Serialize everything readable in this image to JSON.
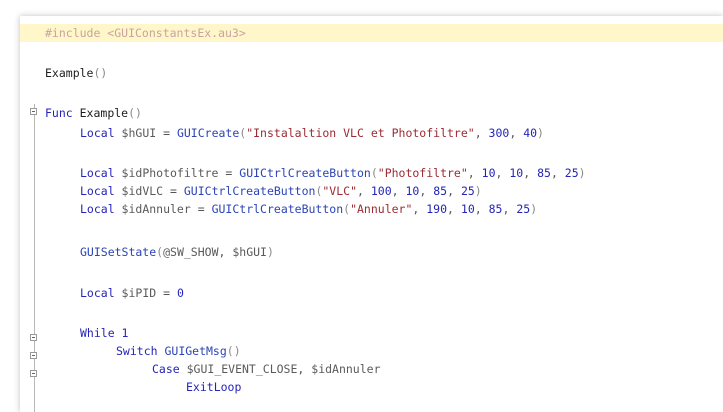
{
  "editor": {
    "colors": {
      "current_line": "#fff6c9",
      "keyword": "#2424b8",
      "string": "#9c2b33",
      "number": "#2424b8",
      "variable": "#5a5a5a"
    },
    "lines": [
      {
        "tokens": [
          {
            "cls": "dim",
            "text": "#include <GUIConstantsEx.au3>"
          }
        ]
      },
      {
        "tokens": [
          {
            "cls": "fn",
            "text": "Example"
          },
          {
            "cls": "paren",
            "text": "()"
          }
        ]
      },
      {
        "tokens": [
          {
            "cls": "kw",
            "text": "Func "
          },
          {
            "cls": "fn",
            "text": "Example"
          },
          {
            "cls": "paren",
            "text": "()"
          }
        ]
      },
      {
        "tokens": [
          {
            "cls": "kw",
            "text": "Local "
          },
          {
            "cls": "var",
            "text": "$hGUI"
          },
          {
            "cls": "op",
            "text": " = "
          },
          {
            "cls": "builtin",
            "text": "GUICreate"
          },
          {
            "cls": "paren",
            "text": "("
          },
          {
            "cls": "str",
            "text": "\"Instalaltion VLC et Photofiltre\""
          },
          {
            "cls": "op",
            "text": ", "
          },
          {
            "cls": "num",
            "text": "300"
          },
          {
            "cls": "op",
            "text": ", "
          },
          {
            "cls": "num",
            "text": "40"
          },
          {
            "cls": "paren",
            "text": ")"
          }
        ]
      },
      {
        "tokens": [
          {
            "cls": "kw",
            "text": "Local "
          },
          {
            "cls": "var",
            "text": "$idPhotofiltre"
          },
          {
            "cls": "op",
            "text": " = "
          },
          {
            "cls": "builtin",
            "text": "GUICtrlCreateButton"
          },
          {
            "cls": "paren",
            "text": "("
          },
          {
            "cls": "str",
            "text": "\"Photofiltre\""
          },
          {
            "cls": "op",
            "text": ", "
          },
          {
            "cls": "num",
            "text": "10"
          },
          {
            "cls": "op",
            "text": ", "
          },
          {
            "cls": "num",
            "text": "10"
          },
          {
            "cls": "op",
            "text": ", "
          },
          {
            "cls": "num",
            "text": "85"
          },
          {
            "cls": "op",
            "text": ", "
          },
          {
            "cls": "num",
            "text": "25"
          },
          {
            "cls": "paren",
            "text": ")"
          }
        ]
      },
      {
        "tokens": [
          {
            "cls": "kw",
            "text": "Local "
          },
          {
            "cls": "var",
            "text": "$idVLC"
          },
          {
            "cls": "op",
            "text": " = "
          },
          {
            "cls": "builtin",
            "text": "GUICtrlCreateButton"
          },
          {
            "cls": "paren",
            "text": "("
          },
          {
            "cls": "str",
            "text": "\"VLC\""
          },
          {
            "cls": "op",
            "text": ", "
          },
          {
            "cls": "num",
            "text": "100"
          },
          {
            "cls": "op",
            "text": ", "
          },
          {
            "cls": "num",
            "text": "10"
          },
          {
            "cls": "op",
            "text": ", "
          },
          {
            "cls": "num",
            "text": "85"
          },
          {
            "cls": "op",
            "text": ", "
          },
          {
            "cls": "num",
            "text": "25"
          },
          {
            "cls": "paren",
            "text": ")"
          }
        ]
      },
      {
        "tokens": [
          {
            "cls": "kw",
            "text": "Local "
          },
          {
            "cls": "var",
            "text": "$idAnnuler"
          },
          {
            "cls": "op",
            "text": " = "
          },
          {
            "cls": "builtin",
            "text": "GUICtrlCreateButton"
          },
          {
            "cls": "paren",
            "text": "("
          },
          {
            "cls": "str",
            "text": "\"Annuler\""
          },
          {
            "cls": "op",
            "text": ", "
          },
          {
            "cls": "num",
            "text": "190"
          },
          {
            "cls": "op",
            "text": ", "
          },
          {
            "cls": "num",
            "text": "10"
          },
          {
            "cls": "op",
            "text": ", "
          },
          {
            "cls": "num",
            "text": "85"
          },
          {
            "cls": "op",
            "text": ", "
          },
          {
            "cls": "num",
            "text": "25"
          },
          {
            "cls": "paren",
            "text": ")"
          }
        ]
      },
      {
        "tokens": [
          {
            "cls": "builtin",
            "text": "GUISetState"
          },
          {
            "cls": "paren",
            "text": "("
          },
          {
            "cls": "macro",
            "text": "@SW_SHOW"
          },
          {
            "cls": "op",
            "text": ", "
          },
          {
            "cls": "var",
            "text": "$hGUI"
          },
          {
            "cls": "paren",
            "text": ")"
          }
        ]
      },
      {
        "tokens": [
          {
            "cls": "kw",
            "text": "Local "
          },
          {
            "cls": "var",
            "text": "$iPID"
          },
          {
            "cls": "op",
            "text": " = "
          },
          {
            "cls": "num",
            "text": "0"
          }
        ]
      },
      {
        "tokens": [
          {
            "cls": "kw",
            "text": "While "
          },
          {
            "cls": "num",
            "text": "1"
          }
        ]
      },
      {
        "tokens": [
          {
            "cls": "kw",
            "text": "Switch "
          },
          {
            "cls": "builtin",
            "text": "GUIGetMsg"
          },
          {
            "cls": "paren",
            "text": "()"
          }
        ]
      },
      {
        "tokens": [
          {
            "cls": "kw",
            "text": "Case "
          },
          {
            "cls": "var",
            "text": "$GUI_EVENT_CLOSE"
          },
          {
            "cls": "op",
            "text": ", "
          },
          {
            "cls": "var",
            "text": "$idAnnuler"
          }
        ]
      },
      {
        "tokens": [
          {
            "cls": "kw",
            "text": "ExitLoop"
          }
        ]
      }
    ]
  }
}
